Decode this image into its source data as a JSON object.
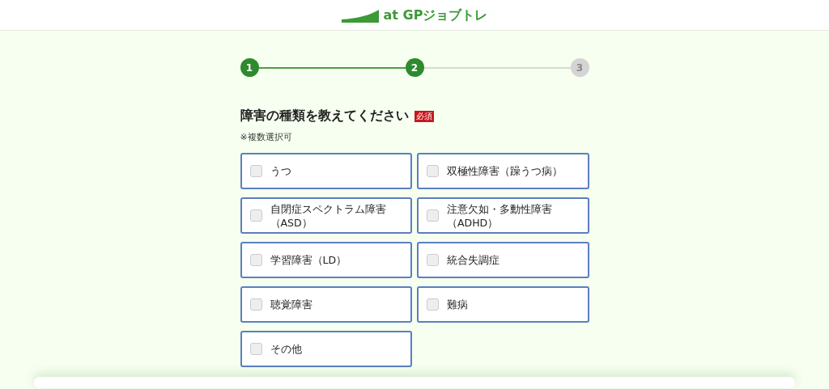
{
  "header": {
    "logo": "at GPジョブトレ"
  },
  "steps": [
    {
      "label": "1",
      "active": true
    },
    {
      "label": "2",
      "active": true
    },
    {
      "label": "3",
      "active": false
    }
  ],
  "question": {
    "title": "障害の種類を教えてください",
    "badge": "必須",
    "note": "※複数選択可"
  },
  "options": [
    {
      "label": "うつ",
      "checked": false
    },
    {
      "label": "双極性障害（躁うつ病）",
      "checked": false
    },
    {
      "label": "自閉症スペクトラム障害（ASD）",
      "checked": false
    },
    {
      "label": "注意欠如・多動性障害（ADHD）",
      "checked": false
    },
    {
      "label": "学習障害（LD）",
      "checked": false
    },
    {
      "label": "統合失調症",
      "checked": false
    },
    {
      "label": "聴覚障害",
      "checked": false
    },
    {
      "label": "難病",
      "checked": false
    },
    {
      "label": "その他",
      "checked": false
    }
  ]
}
